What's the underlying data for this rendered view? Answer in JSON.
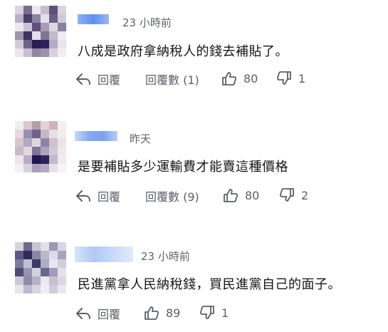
{
  "comments": [
    {
      "time": "23 小時前",
      "text": "八成是政府拿納稅人的錢去補貼了。",
      "reply_label": "回覆",
      "replies_label": "回覆數 (1)",
      "likes": "80",
      "dislikes": "1",
      "avatar_colors": [
        "#d8d4e0",
        "#7a6c8c",
        "#ece9f0",
        "#c4bfcd",
        "#5e517a",
        "#d9d5df",
        "#b8b1c6",
        "#4a3f66",
        "#8d849f",
        "#e4e1ea",
        "#6b5f86",
        "#cfcad8",
        "#ebe8ef",
        "#c9c4d2",
        "#5c4f7a",
        "#a69cb6",
        "#dcd8e2",
        "#8a80a0",
        "#9e94b0",
        "#3d3360",
        "#e2dee8",
        "#7f7594",
        "#c1bacd",
        "#eeebf2",
        "#d0cbd8",
        "#6e6488",
        "#281d55",
        "#2e2358",
        "#b3abc3",
        "#e8e5ed",
        "#eae7ef",
        "#c6c0d0",
        "#8f86a3",
        "#9a91ad",
        "#d7d3de",
        "#f0eef3"
      ]
    },
    {
      "time": "昨天",
      "text": "是要補貼多少運輸費才能賣這種價格",
      "reply_label": "回覆",
      "replies_label": "回覆數 (9)",
      "likes": "80",
      "dislikes": "2",
      "avatar_colors": [
        "#f0ecef",
        "#d9c9cf",
        "#b79ba6",
        "#e3d3d8",
        "#ccb4bd",
        "#f3eff1",
        "#e6d8dc",
        "#9b8fb0",
        "#6d6190",
        "#c8b8c6",
        "#e9dfe2",
        "#f1ecee",
        "#d7c6cb",
        "#b5a8c2",
        "#e0d5db",
        "#8e83a5",
        "#cfc2cc",
        "#ebe3e6",
        "#c9bac5",
        "#e2d9df",
        "#7e7398",
        "#afa4bf",
        "#d4c8d1",
        "#efe9ec",
        "#ece7ea",
        "#b8adc6",
        "#1f1650",
        "#2b2258",
        "#c3b9cb",
        "#f0ebee",
        "#f4f1f3",
        "#d9d2dc",
        "#a79ebb",
        "#b2aac2",
        "#e6e1e7",
        "#f6f4f6"
      ]
    },
    {
      "time": "23 小時前",
      "text": "民進黨拿人民納稅錢，買民進黨自己的面子。",
      "reply_label": "回覆",
      "likes": "89",
      "dislikes": "1",
      "avatar_colors": [
        "#d6d3de",
        "#6e6a8c",
        "#c8c4d2",
        "#e2dff0",
        "#9d99b3",
        "#d9d6e2",
        "#5c587e",
        "#2f2b5c",
        "#8a86a4",
        "#bcb8ca",
        "#dedbea",
        "#a7a3bb",
        "#7d79a0",
        "#c2bed2",
        "#3c3866",
        "#b0acc3",
        "#e8e6f0",
        "#d1cedb",
        "#4f4b75",
        "#9894b0",
        "#d4d1df",
        "#6a6690",
        "#a19dba",
        "#e4e2ec",
        "#ccc9d6",
        "#8f8ba8",
        "#b6b2c7",
        "#ece9f2",
        "#c5c1d1",
        "#dad7e3",
        "#e6e4ec",
        "#bfbbcc",
        "#d8d5e1",
        "#f0eef4",
        "#cfccd9",
        "#e9e7ef"
      ]
    }
  ]
}
